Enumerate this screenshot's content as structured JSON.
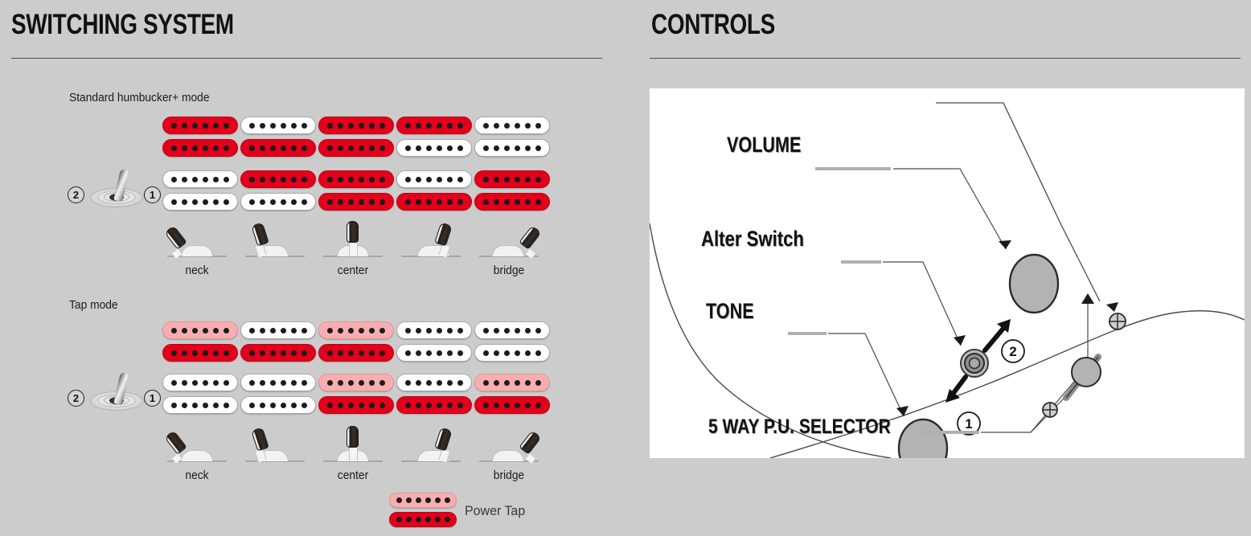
{
  "page": {
    "background_color": "#cccccc"
  },
  "switching": {
    "title": "SWITCHING SYSTEM",
    "modes": [
      {
        "id": "humbucker",
        "label": "Standard humbucker+ mode",
        "toggle": {
          "left_number": "2",
          "right_number": "1",
          "lever_direction": "right"
        },
        "rows": [
          {
            "row": 1,
            "coils": [
              {
                "top": "red",
                "bottom": "red"
              },
              {
                "top": "white",
                "bottom": "red"
              },
              {
                "top": "red",
                "bottom": "red"
              },
              {
                "top": "red",
                "bottom": "white"
              },
              {
                "top": "white",
                "bottom": "white"
              }
            ]
          },
          {
            "row": 2,
            "coils": [
              {
                "top": "white",
                "bottom": "white"
              },
              {
                "top": "red",
                "bottom": "white"
              },
              {
                "top": "red",
                "bottom": "red"
              },
              {
                "top": "white",
                "bottom": "red"
              },
              {
                "top": "red",
                "bottom": "red"
              }
            ]
          }
        ],
        "positions": [
          {
            "label": "neck",
            "lever": "far-left"
          },
          {
            "label": "",
            "lever": "left"
          },
          {
            "label": "center",
            "lever": "middle"
          },
          {
            "label": "",
            "lever": "right"
          },
          {
            "label": "bridge",
            "lever": "far-right"
          }
        ]
      },
      {
        "id": "tap",
        "label": "Tap mode",
        "toggle": {
          "left_number": "2",
          "right_number": "1",
          "lever_direction": "right"
        },
        "rows": [
          {
            "row": 1,
            "coils": [
              {
                "top": "pink",
                "bottom": "red"
              },
              {
                "top": "white",
                "bottom": "red"
              },
              {
                "top": "pink",
                "bottom": "red"
              },
              {
                "top": "white",
                "bottom": "white"
              },
              {
                "top": "white",
                "bottom": "white"
              }
            ]
          },
          {
            "row": 2,
            "coils": [
              {
                "top": "white",
                "bottom": "white"
              },
              {
                "top": "white",
                "bottom": "white"
              },
              {
                "top": "pink",
                "bottom": "red"
              },
              {
                "top": "white",
                "bottom": "red"
              },
              {
                "top": "pink",
                "bottom": "red"
              }
            ]
          }
        ],
        "positions": [
          {
            "label": "neck",
            "lever": "far-left"
          },
          {
            "label": "",
            "lever": "left"
          },
          {
            "label": "center",
            "lever": "middle"
          },
          {
            "label": "",
            "lever": "right"
          },
          {
            "label": "bridge",
            "lever": "far-right"
          }
        ]
      }
    ],
    "legend": {
      "label": "Power Tap",
      "swatch": {
        "top": "pink",
        "bottom": "red"
      }
    },
    "colors": {
      "red": "#e2001a",
      "pink": "#f8aeb0",
      "white": "#ffffff",
      "pole": "#1c1c1c"
    }
  },
  "controls": {
    "title": "CONTROLS",
    "labels": [
      {
        "id": "volume",
        "text": "VOLUME"
      },
      {
        "id": "alter-switch",
        "text": "Alter Switch"
      },
      {
        "id": "tone",
        "text": "TONE"
      },
      {
        "id": "selector",
        "text": "5 WAY P.U. SELECTOR"
      }
    ],
    "callout_numbers": [
      {
        "id": "alter-up",
        "text": "2"
      },
      {
        "id": "alter-down",
        "text": "1"
      }
    ],
    "knob_fill": "#b3b3b3",
    "figure_background": "#ffffff"
  }
}
